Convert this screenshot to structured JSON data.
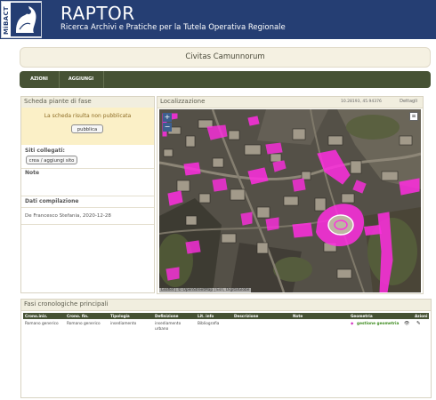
{
  "header": {
    "logo_text": "MiBACT",
    "app_title": "RAPTOR",
    "app_subtitle": "Ricerca Archivi e Pratiche per la Tutela Operativa Regionale"
  },
  "page": {
    "title": "Civitas Camunnorum"
  },
  "actions": {
    "azioni": "AZIONI",
    "aggiungi": "AGGIUNGI"
  },
  "left_panel": {
    "heading": "Scheda piante di fase",
    "notice": "La scheda risulta non pubblicata",
    "publish_button": "pubblica",
    "siti_label": "Siti collegati:",
    "siti_button": "crea / aggiungi sito",
    "note_label": "Note",
    "dati_label": "Dati compilazione",
    "dati_value": "De Francesco Stefania, 2020-12-28"
  },
  "map_panel": {
    "heading": "Localizzazione",
    "coords": "10.28193, 45.94376",
    "details_link": "Dettagli",
    "zoom_in": "+",
    "zoom_out": "−",
    "layers": "≡",
    "attribution": "Leaflet | © OpenStreetMap | Esri, DigitalGlobe"
  },
  "fasi": {
    "heading": "Fasi cronologiche principali",
    "columns": [
      "Crono.iniz.",
      "Crono. fin.",
      "Tipologia",
      "Definizione",
      "Lit. info",
      "Descrizione",
      "Note",
      "Geometria",
      "Azioni"
    ],
    "row": {
      "crono_iniz": "Romano generico",
      "crono_fin": "Romano generico",
      "tipologia": "insediamento",
      "definizione_line1": "insediamento",
      "definizione_line2": "urbano",
      "lit_info": "Bibliografia",
      "descrizione": "",
      "note": "",
      "geometria_icon": "◆",
      "geometria": "gestione geometria",
      "view_icon": "👁",
      "edit_icon": "✎"
    }
  },
  "colors": {
    "header_bg": "#253e73",
    "action_bar": "#465234",
    "highlight": "#ff2de0",
    "notice_bg": "#fbf0c7"
  }
}
